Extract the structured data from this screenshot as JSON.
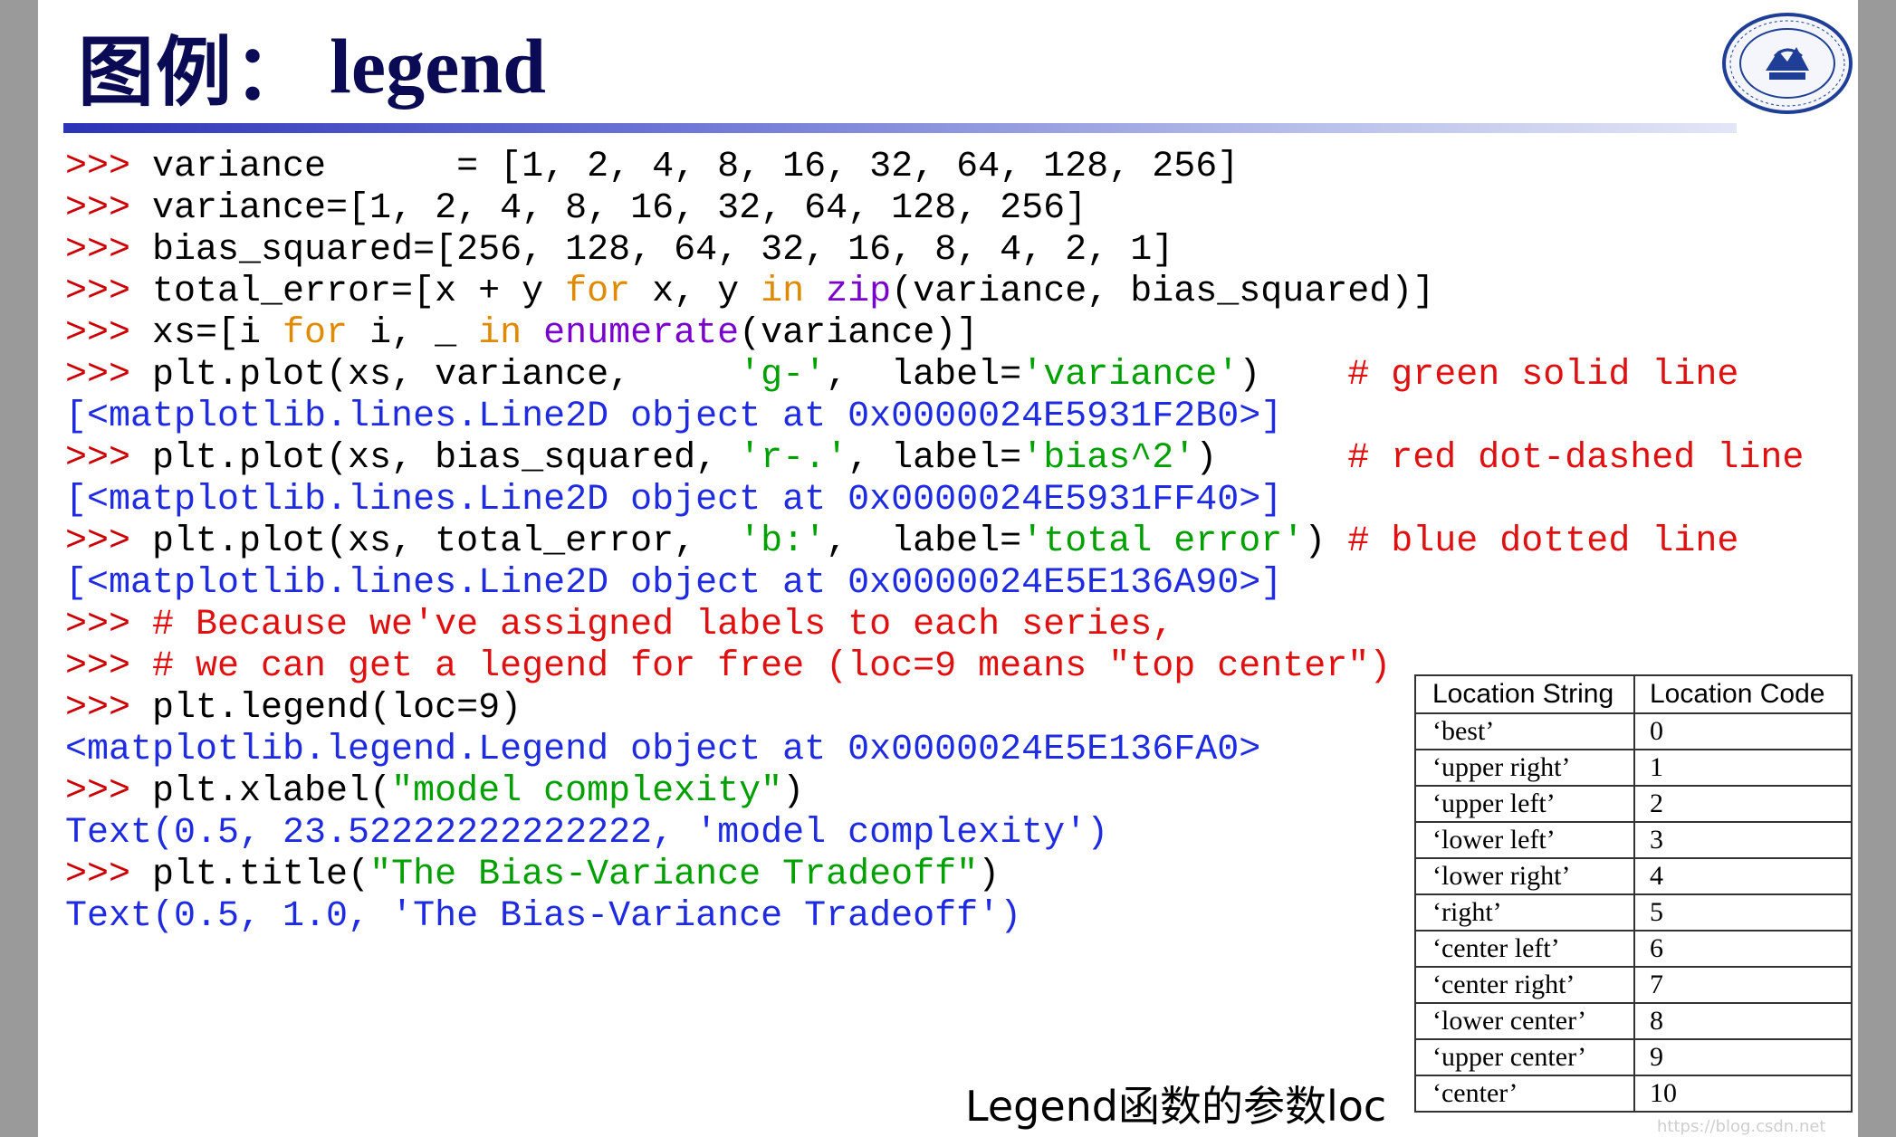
{
  "title": {
    "cjk": "图例：",
    "en": "legend"
  },
  "logo_icon": "university-seal-icon",
  "code_lines": [
    [
      [
        "k",
        ">>> "
      ],
      [
        "n",
        "variance      = [1, 2, 4, 8, 16, 32, 64, 128, 256]"
      ]
    ],
    [
      [
        "k",
        ">>> "
      ],
      [
        "n",
        "variance=[1, 2, 4, 8, 16, 32, 64, 128, 256]"
      ]
    ],
    [
      [
        "k",
        ">>> "
      ],
      [
        "n",
        "bias_squared=[256, 128, 64, 32, 16, 8, 4, 2, 1]"
      ]
    ],
    [
      [
        "k",
        ">>> "
      ],
      [
        "n",
        "total_error=[x + y "
      ],
      [
        "kw",
        "for"
      ],
      [
        "n",
        " x, y "
      ],
      [
        "kw",
        "in"
      ],
      [
        "n",
        " "
      ],
      [
        "b",
        "zip"
      ],
      [
        "n",
        "(variance, bias_squared)]"
      ]
    ],
    [
      [
        "k",
        ">>> "
      ],
      [
        "n",
        "xs=[i "
      ],
      [
        "kw",
        "for"
      ],
      [
        "n",
        " i, _ "
      ],
      [
        "kw",
        "in"
      ],
      [
        "n",
        " "
      ],
      [
        "b",
        "enumerate"
      ],
      [
        "n",
        "(variance)]"
      ]
    ],
    [
      [
        "k",
        ">>> "
      ],
      [
        "n",
        "plt.plot(xs, variance,     "
      ],
      [
        "s",
        "'g-'"
      ],
      [
        "n",
        ",  label="
      ],
      [
        "s",
        "'variance'"
      ],
      [
        "n",
        ")    "
      ],
      [
        "c",
        "# green solid line"
      ]
    ],
    [
      [
        "o",
        "[<matplotlib.lines.Line2D object at 0x0000024E5931F2B0>]"
      ]
    ],
    [
      [
        "k",
        ">>> "
      ],
      [
        "n",
        "plt.plot(xs, bias_squared, "
      ],
      [
        "s",
        "'r-.'"
      ],
      [
        "n",
        ", label="
      ],
      [
        "s",
        "'bias^2'"
      ],
      [
        "n",
        ")      "
      ],
      [
        "c",
        "# red dot-dashed line"
      ]
    ],
    [
      [
        "o",
        "[<matplotlib.lines.Line2D object at 0x0000024E5931FF40>]"
      ]
    ],
    [
      [
        "k",
        ">>> "
      ],
      [
        "n",
        "plt.plot(xs, total_error,  "
      ],
      [
        "s",
        "'b:'"
      ],
      [
        "n",
        ",  label="
      ],
      [
        "s",
        "'total error'"
      ],
      [
        "n",
        ") "
      ],
      [
        "c",
        "# blue dotted line"
      ]
    ],
    [
      [
        "o",
        "[<matplotlib.lines.Line2D object at 0x0000024E5E136A90>]"
      ]
    ],
    [
      [
        "k",
        ">>> "
      ],
      [
        "c",
        "# Because we've assigned labels to each series,"
      ]
    ],
    [
      [
        "k",
        ">>> "
      ],
      [
        "c",
        "# we can get a legend for free (loc=9 means \"top center\")"
      ]
    ],
    [
      [
        "k",
        ">>> "
      ],
      [
        "n",
        "plt.legend(loc=9)"
      ]
    ],
    [
      [
        "o",
        "<matplotlib.legend.Legend object at 0x0000024E5E136FA0>"
      ]
    ],
    [
      [
        "k",
        ">>> "
      ],
      [
        "n",
        "plt.xlabel("
      ],
      [
        "s",
        "\"model complexity\""
      ],
      [
        "n",
        ")"
      ]
    ],
    [
      [
        "o",
        "Text(0.5, 23.52222222222222, 'model complexity')"
      ]
    ],
    [
      [
        "k",
        ">>> "
      ],
      [
        "n",
        "plt.title("
      ],
      [
        "s",
        "\"The Bias-Variance Tradeoff\""
      ],
      [
        "n",
        ")"
      ]
    ],
    [
      [
        "o",
        "Text(0.5, 1.0, 'The Bias-Variance Tradeoff')"
      ]
    ]
  ],
  "caption": "Legend函数的参数loc",
  "loc_table": {
    "headers": [
      "Location String",
      "Location Code"
    ],
    "rows": [
      [
        "‘best’",
        "0"
      ],
      [
        "‘upper right’",
        "1"
      ],
      [
        "‘upper left’",
        "2"
      ],
      [
        "‘lower left’",
        "3"
      ],
      [
        "‘lower right’",
        "4"
      ],
      [
        "‘right’",
        "5"
      ],
      [
        "‘center left’",
        "6"
      ],
      [
        "‘center right’",
        "7"
      ],
      [
        "‘lower center’",
        "8"
      ],
      [
        "‘upper center’",
        "9"
      ],
      [
        "‘center’",
        "10"
      ]
    ]
  },
  "watermark": "https://blog.csdn.net"
}
